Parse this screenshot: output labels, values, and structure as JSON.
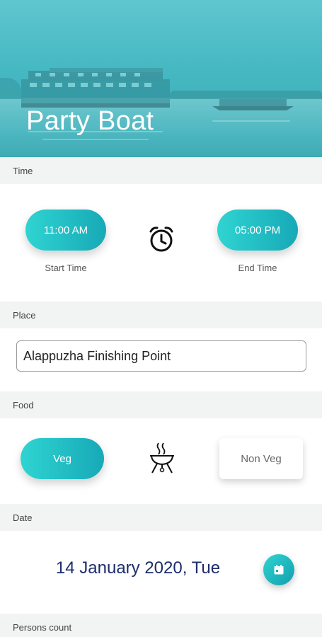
{
  "hero": {
    "title": "Party Boat"
  },
  "sections": {
    "time": "Time",
    "place": "Place",
    "food": "Food",
    "date": "Date",
    "persons": "Persons count"
  },
  "time": {
    "start_value": "11:00 AM",
    "start_caption": "Start Time",
    "end_value": "05:00 PM",
    "end_caption": "End Time",
    "icon": "alarm-clock-icon"
  },
  "place": {
    "value": "Alappuzha Finishing Point"
  },
  "food": {
    "veg_label": "Veg",
    "nonveg_label": "Non Veg",
    "icon": "grill-icon"
  },
  "date": {
    "value": "14 January 2020, Tue",
    "icon": "calendar-icon"
  },
  "colors": {
    "accent_start": "#2fd4d1",
    "accent_end": "#17a9b7",
    "date_text": "#1c2d6b",
    "section_bg": "#f2f3f3"
  }
}
